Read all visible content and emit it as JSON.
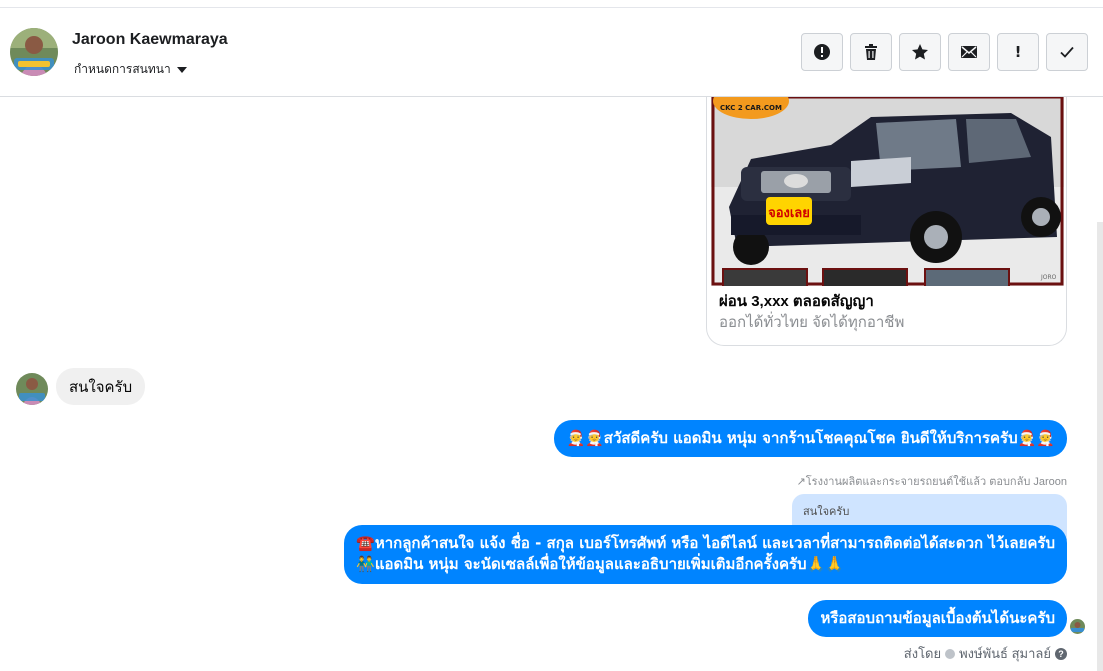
{
  "header": {
    "contact_name": "Jaroon Kaewmaraya",
    "assign_label": "กำหนดการสนทนา",
    "actions": [
      {
        "name": "spam-button",
        "icon": "alert-circle-icon"
      },
      {
        "name": "delete-button",
        "icon": "trash-icon"
      },
      {
        "name": "star-button",
        "icon": "star-icon"
      },
      {
        "name": "mark-unread-button",
        "icon": "envelope-icon"
      },
      {
        "name": "follow-up-button",
        "icon": "exclamation-icon",
        "label": "!"
      },
      {
        "name": "mark-done-button",
        "icon": "check-icon"
      }
    ]
  },
  "card": {
    "title": "ผ่อน 3,xxx ตลอดสัญญา",
    "subtitle": "ออกได้ทั่วไทย จัดได้ทุกอาชีพ",
    "badge": "CKC 2 CAR.COM",
    "sticker": "จองเลย",
    "watermark": "JORO"
  },
  "messages": {
    "incoming_1": "สนใจครับ",
    "outgoing_1": "🧑‍🎄🧑‍🎄สวัสดีครับ แอดมิน หนุ่ม จากร้านโชคคุณโชค ยินดีให้บริการครับ🧑‍🎄🧑‍🎄",
    "reply_meta": "↗โรงงานผลิตและกระจายรถยนต์ใช้แล้ว ตอบกลับ Jaroon",
    "quoted_text": "สนใจครับ",
    "outgoing_2_line1": "☎️หากลูกค้าสนใจ แจ้ง ชื่อ - สกุล เบอร์โทรศัพท์ หรือ ไอดีไลน์ และเวลาที่สามารถติดต่อได้สะดวก ไว้เลยครับ",
    "outgoing_2_line2": "👬แอดมิน หนุ่ม จะนัดเซลล์เพื่อให้ข้อมูลและอธิบายเพิ่มเติมอีกครั้งครับ🙏🙏",
    "outgoing_3": "หรือสอบถามข้อมูลเบื้องต้นได้นะครับ",
    "sent_by_label": "ส่งโดย",
    "sent_by_name": "พงษ์พันธ์ สุมาลย์"
  },
  "colors": {
    "accent": "#0084ff",
    "incoming_bubble": "#f0f0f0",
    "quoted_bg": "#cfe4ff"
  }
}
